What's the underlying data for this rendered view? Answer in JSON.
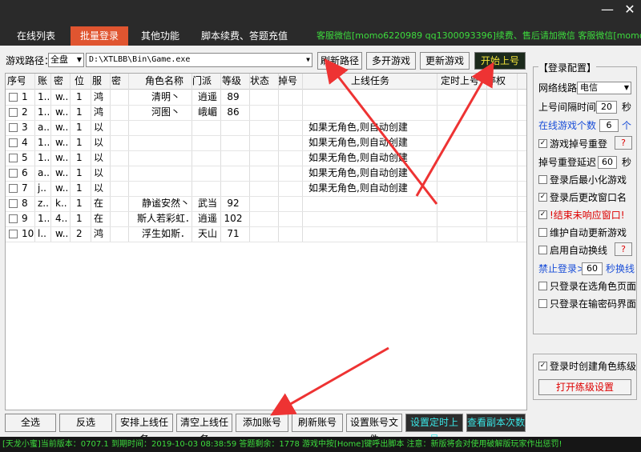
{
  "window": {
    "minimize": "—",
    "close": "✕"
  },
  "tabs": [
    {
      "label": "在线列表",
      "active": false
    },
    {
      "label": "批量登录",
      "active": true
    },
    {
      "label": "其他功能",
      "active": false
    },
    {
      "label": "脚本续费、答题充值",
      "active": false
    }
  ],
  "marquee": "客服微信[momo6220989 qq1300093396]续费、售后请加微信    客服微信[momo6220",
  "path": {
    "label": "游戏路径：",
    "drive": "全盘",
    "value": "D:\\XTLBB\\Bin\\Game.exe"
  },
  "toolbar": {
    "refresh_path": "刷新路径",
    "multi_open": "多开游戏",
    "update_game": "更新游戏",
    "start_login": "开始上号"
  },
  "table": {
    "headers": [
      "序号",
      "账",
      "密",
      "位",
      "服",
      "密",
      "角色名称",
      "门派",
      "等级",
      "状态",
      "掉号",
      "上线任务",
      "定时上号",
      "停权"
    ],
    "rows": [
      [
        "1",
        "1..",
        "w..",
        "1",
        "鸿",
        "",
        "清明丶",
        "逍遥",
        "89",
        "",
        "",
        "",
        ""
      ],
      [
        "2",
        "1..",
        "w..",
        "1",
        "鸿",
        "",
        "河图丶",
        "峨嵋",
        "86",
        "",
        "",
        "",
        ""
      ],
      [
        "3",
        "a..",
        "w..",
        "1",
        "以",
        "",
        "",
        "",
        "",
        "",
        "",
        "如果无角色,则自动创建",
        ""
      ],
      [
        "4",
        "1..",
        "w..",
        "1",
        "以",
        "",
        "",
        "",
        "",
        "",
        "",
        "如果无角色,则自动创建",
        ""
      ],
      [
        "5",
        "1..",
        "w..",
        "1",
        "以",
        "",
        "",
        "",
        "",
        "",
        "",
        "如果无角色,则自动创建",
        ""
      ],
      [
        "6",
        "a..",
        "w..",
        "1",
        "以",
        "",
        "",
        "",
        "",
        "",
        "",
        "如果无角色,则自动创建",
        ""
      ],
      [
        "7",
        "j..",
        "w..",
        "1",
        "以",
        "",
        "",
        "",
        "",
        "",
        "",
        "如果无角色,则自动创建",
        ""
      ],
      [
        "8",
        "z..",
        "k..",
        "1",
        "在",
        "",
        "静谧安然丶",
        "武当",
        "92",
        "",
        "",
        "",
        ""
      ],
      [
        "9",
        "1..",
        "4..",
        "1",
        "在",
        "",
        "斯人若彩虹．",
        "逍遥",
        "102",
        "",
        "",
        "",
        ""
      ],
      [
        "10",
        "l..",
        "w..",
        "2",
        "鸿",
        "",
        "浮生如斯．",
        "天山",
        "71",
        "",
        "",
        "",
        ""
      ]
    ]
  },
  "config": {
    "title": "【登录配置】",
    "network_label": "网络线路",
    "network_value": "电信",
    "interval_label": "上号间隔时间",
    "interval_value": "20",
    "interval_unit": "秒",
    "online_count_label": "在线游戏个数",
    "online_count_value": "6",
    "online_count_unit": "个",
    "relogin_label": "游戏掉号重登",
    "relogin_help": "?",
    "relogin_delay_label": "掉号重登延迟",
    "relogin_delay_value": "60",
    "relogin_delay_unit": "秒",
    "minimize_label": "登录后最小化游戏",
    "rename_label": "登录后更改窗口名",
    "kill_unresponsive_label": "!结束未响应窗口!",
    "auto_update_label": "维护自动更新游戏",
    "auto_switch_label": "启用自动换线",
    "auto_switch_help": "?",
    "ban_label": "禁止登录>",
    "ban_value": "60",
    "ban_unit": "秒换线",
    "only_char_page_label": "只登录在选角色页面",
    "only_pwd_page_label": "只登录在输密码界面",
    "create_level_label": "登录时创建角色练级",
    "open_level_settings": "打开练级设置"
  },
  "bottom_buttons": {
    "select_all": "全选",
    "invert": "反选",
    "arrange_tasks": "安排上线任务",
    "clear_tasks": "清空上线任务",
    "add_account": "添加账号",
    "refresh_account": "刷新账号",
    "account_file": "设置账号文件",
    "timed_login": "设置定时上号",
    "view_dungeon": "查看副本次数"
  },
  "status": "[天龙小蜜]当前版本：0707.1    到期时间：2019-10-03 08:38:59   答题剩余：1778   游戏中按[Home]键呼出脚本   注意：新版将会对使用破解版玩家作出惩罚!"
}
